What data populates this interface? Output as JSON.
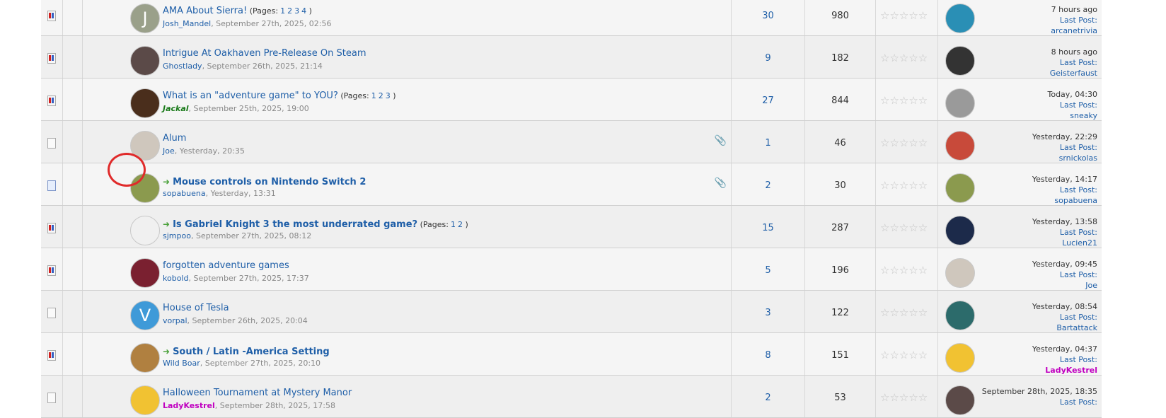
{
  "topics": [
    {
      "title": "AMA About Sierra!",
      "pages": [
        "1",
        "2",
        "3",
        "4"
      ],
      "pages_label": "(Pages:",
      "author": "Josh_Mandel",
      "date": ", September 27th, 2025, 02:56",
      "replies": "30",
      "views": "980",
      "last_time": "7 hours ago",
      "last_user": "arcanetrivia",
      "icon": "hot",
      "avatar_letter": "J",
      "avatar_color": "#9aa08a",
      "attach": false,
      "sticky_arrow": false
    },
    {
      "title": "Intrigue At Oakhaven Pre-Release On Steam",
      "pages": [],
      "pages_label": "",
      "author": "Ghostlady",
      "date": ", September 26th, 2025, 21:14",
      "replies": "9",
      "views": "182",
      "last_time": "8 hours ago",
      "last_user": "Geisterfaust",
      "icon": "hot",
      "avatar_letter": "",
      "avatar_color": "#5b4a48",
      "attach": false,
      "sticky_arrow": false
    },
    {
      "title": "What is an \"adventure game\" to YOU?",
      "pages": [
        "1",
        "2",
        "3"
      ],
      "pages_label": "(Pages:",
      "author": "Jackal",
      "date": ", September 25th, 2025, 19:00",
      "replies": "27",
      "views": "844",
      "last_time": "Today, 04:30",
      "last_user": "sneaky",
      "icon": "hot",
      "avatar_letter": "",
      "avatar_color": "#4a2e1c",
      "attach": false,
      "sticky_arrow": false
    },
    {
      "title": "Alum",
      "pages": [],
      "pages_label": "",
      "author": "Joe",
      "date": ", Yesterday, 20:35",
      "replies": "1",
      "views": "46",
      "last_time": "Yesterday, 22:29",
      "last_user": "srnickolas",
      "icon": "plain",
      "avatar_letter": "",
      "avatar_color": "#cfc7bd",
      "attach": true,
      "sticky_arrow": false
    },
    {
      "title": "Mouse controls on Nintendo Switch 2",
      "pages": [],
      "pages_label": "",
      "author": "sopabuena",
      "date": ", Yesterday, 13:31",
      "replies": "2",
      "views": "30",
      "last_time": "Yesterday, 14:17",
      "last_user": "sopabuena",
      "icon": "new",
      "avatar_letter": "",
      "avatar_color": "#8b9a4e",
      "attach": true,
      "sticky_arrow": true
    },
    {
      "title": "Is Gabriel Knight 3 the most underrated game?",
      "pages": [
        "1",
        "2"
      ],
      "pages_label": "(Pages:",
      "author": "sjmpoo",
      "date": ", September 27th, 2025, 08:12",
      "replies": "15",
      "views": "287",
      "last_time": "Yesterday, 13:58",
      "last_user": "Lucien21",
      "icon": "hot",
      "avatar_letter": "",
      "avatar_color": "#f0f0f0",
      "attach": false,
      "sticky_arrow": true
    },
    {
      "title": "forgotten adventure games",
      "pages": [],
      "pages_label": "",
      "author": "kobold",
      "date": ", September 27th, 2025, 17:37",
      "replies": "5",
      "views": "196",
      "last_time": "Yesterday, 09:45",
      "last_user": "Joe",
      "icon": "hot",
      "avatar_letter": "",
      "avatar_color": "#7a2030",
      "attach": false,
      "sticky_arrow": false
    },
    {
      "title": "House of Tesla",
      "pages": [],
      "pages_label": "",
      "author": "vorpal",
      "date": ", September 26th, 2025, 20:04",
      "replies": "3",
      "views": "122",
      "last_time": "Yesterday, 08:54",
      "last_user": "Bartattack",
      "icon": "plain",
      "avatar_letter": "V",
      "avatar_color": "#3f9ad8",
      "attach": false,
      "sticky_arrow": false
    },
    {
      "title": "South / Latin -America Setting",
      "pages": [],
      "pages_label": "",
      "author": "Wild Boar",
      "date": ", September 27th, 2025, 20:10",
      "replies": "8",
      "views": "151",
      "last_time": "Yesterday, 04:37",
      "last_user": "LadyKestrel",
      "icon": "hot",
      "avatar_letter": "",
      "avatar_color": "#b08040",
      "attach": false,
      "sticky_arrow": true
    },
    {
      "title": "Halloween Tournament at Mystery Manor",
      "pages": [],
      "pages_label": "",
      "author": "LadyKestrel",
      "date": ", September 28th, 2025, 17:58",
      "replies": "2",
      "views": "53",
      "last_time": "September 28th, 2025, 18:35",
      "last_user": "",
      "icon": "plain",
      "avatar_letter": "",
      "avatar_color": "#f1c232",
      "attach": false,
      "sticky_arrow": false
    }
  ],
  "labels": {
    "last_post": "Last Post:",
    "pages_close": ")",
    "arrow": "➜",
    "attach_icon": "📎",
    "stars": "☆☆☆☆☆"
  },
  "last_avatar_colors": [
    "#2a8fb5",
    "#333333",
    "#9a9a9a",
    "#c84a3a",
    "#8b9a4e",
    "#1c2a4a",
    "#cfc7bd",
    "#2c6b6b",
    "#f1c232",
    "#5b4a48"
  ]
}
